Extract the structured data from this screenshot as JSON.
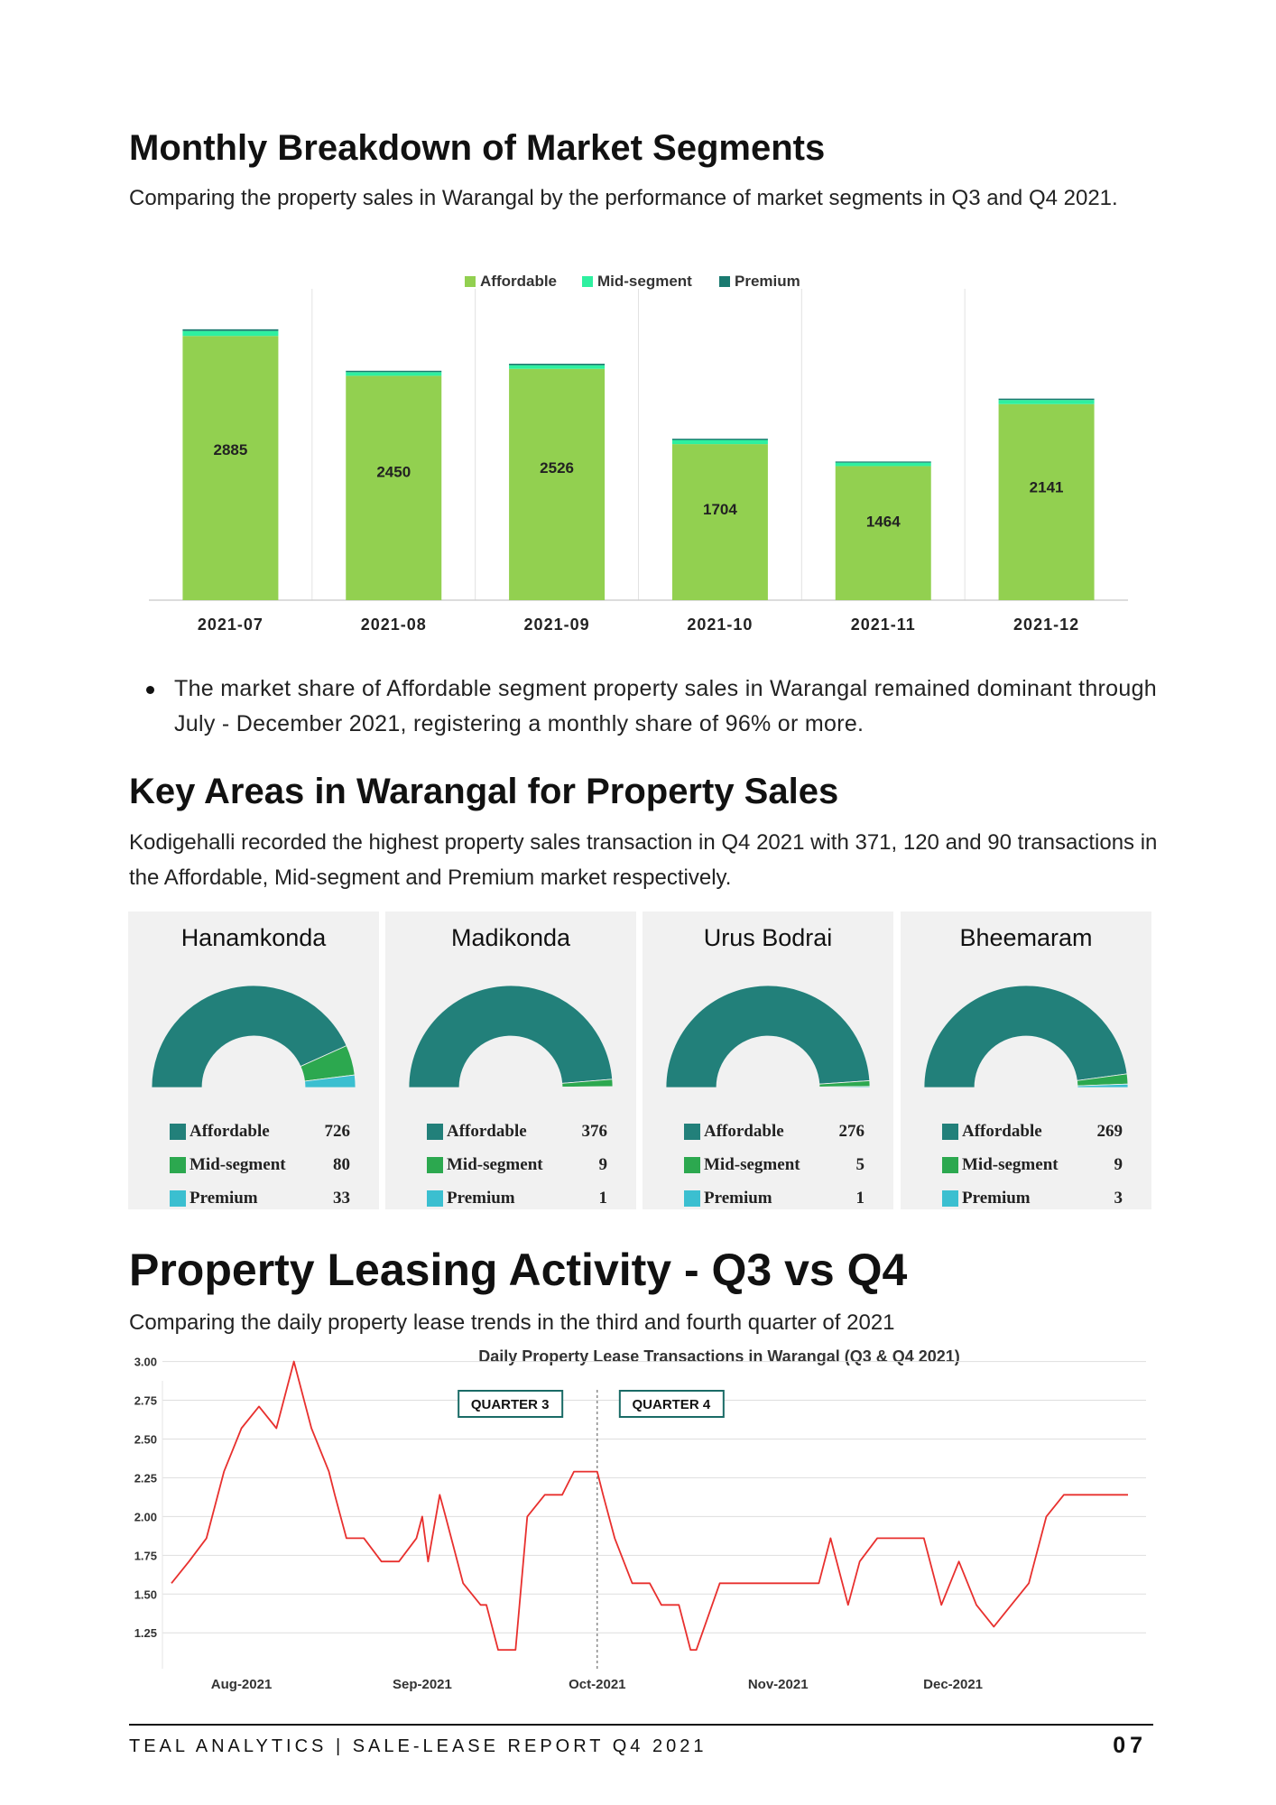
{
  "sections": {
    "monthly": {
      "heading": "Monthly Breakdown of Market Segments",
      "intro": "Comparing the property sales in Warangal  by the performance of market segments in Q3 and Q4 2021."
    },
    "bullet": "The market share of Affordable segment property sales in Warangal remained dominant through July - December 2021, registering a monthly share of 96% or more.",
    "key_areas": {
      "heading": "Key Areas in Warangal for Property Sales",
      "intro": "Kodigehalli recorded the highest property sales transaction in Q4 2021 with 371, 120 and 90 transactions in the Affordable, Mid-segment and Premium market respectively."
    },
    "leasing": {
      "heading": "Property Leasing Activity - Q3 vs Q4",
      "intro": "Comparing the daily property lease trends in the third and fourth quarter of 2021"
    }
  },
  "colors": {
    "affordable_bar": "#92d050",
    "mid_bar": "#2ef0a0",
    "premium_bar": "#1a7a70",
    "donut_affordable": "#22807a",
    "donut_mid": "#2ca84f",
    "donut_premium": "#3bbfd0",
    "line": "#e8302e"
  },
  "chart_data": [
    {
      "type": "bar",
      "stacked": true,
      "categories": [
        "2021-07",
        "2021-08",
        "2021-09",
        "2021-10",
        "2021-11",
        "2021-12"
      ],
      "series": [
        {
          "name": "Affordable",
          "values": [
            2885,
            2450,
            2526,
            1704,
            1464,
            2141
          ]
        },
        {
          "name": "Mid-segment",
          "values": [
            55,
            40,
            40,
            45,
            38,
            45
          ]
        },
        {
          "name": "Premium",
          "values": [
            18,
            15,
            16,
            14,
            12,
            15
          ]
        }
      ],
      "data_labels": [
        "2885",
        "2450",
        "2526",
        "1704",
        "1464",
        "2141"
      ],
      "legend": "top-center",
      "grid": false,
      "ylim": [
        0,
        3400
      ]
    },
    {
      "type": "pie",
      "variant": "half-donut",
      "title": "Hanamkonda",
      "labels": [
        "Affordable",
        "Mid-segment",
        "Premium"
      ],
      "values": [
        726,
        80,
        33
      ]
    },
    {
      "type": "pie",
      "variant": "half-donut",
      "title": "Madikonda",
      "labels": [
        "Affordable",
        "Mid-segment",
        "Premium"
      ],
      "values": [
        376,
        9,
        1
      ]
    },
    {
      "type": "pie",
      "variant": "half-donut",
      "title": "Urus Bodrai",
      "labels": [
        "Affordable",
        "Mid-segment",
        "Premium"
      ],
      "values": [
        276,
        5,
        1
      ]
    },
    {
      "type": "pie",
      "variant": "half-donut",
      "title": "Bheemaram",
      "labels": [
        "Affordable",
        "Mid-segment",
        "Premium"
      ],
      "values": [
        269,
        9,
        3
      ]
    },
    {
      "type": "line",
      "title": "Daily Property Lease Transactions in Warangal (Q3 & Q4 2021)",
      "x_tick_labels": [
        "Aug-2021",
        "Sep-2021",
        "Oct-2021",
        "Nov-2021",
        "Dec-2021"
      ],
      "y_ticks": [
        "1.25",
        "1.50",
        "1.75",
        "2.00",
        "2.25",
        "2.50",
        "2.75",
        "3.00"
      ],
      "ylim": [
        1.1,
        3.05
      ],
      "grid": true,
      "annotations": [
        "QUARTER 3",
        "QUARTER 4"
      ],
      "quarter_divider": "2021-10-01",
      "x": [
        "2021-07-20",
        "2021-07-23",
        "2021-07-26",
        "2021-07-29",
        "2021-08-01",
        "2021-08-04",
        "2021-08-07",
        "2021-08-10",
        "2021-08-13",
        "2021-08-16",
        "2021-08-17",
        "2021-08-19",
        "2021-08-22",
        "2021-08-25",
        "2021-08-28",
        "2021-08-31",
        "2021-09-01",
        "2021-09-02",
        "2021-09-04",
        "2021-09-05",
        "2021-09-08",
        "2021-09-11",
        "2021-09-12",
        "2021-09-14",
        "2021-09-17",
        "2021-09-18",
        "2021-09-19",
        "2021-09-22",
        "2021-09-25",
        "2021-09-27",
        "2021-09-29",
        "2021-09-30",
        "2021-10-01",
        "2021-10-02",
        "2021-10-04",
        "2021-10-07",
        "2021-10-10",
        "2021-10-12",
        "2021-10-15",
        "2021-10-17",
        "2021-10-18",
        "2021-10-22",
        "2021-10-24",
        "2021-11-01",
        "2021-11-05",
        "2021-11-08",
        "2021-11-10",
        "2021-11-13",
        "2021-11-15",
        "2021-11-18",
        "2021-11-20",
        "2021-11-23",
        "2021-11-26",
        "2021-11-29",
        "2021-12-02",
        "2021-12-05",
        "2021-12-08",
        "2021-12-11",
        "2021-12-14",
        "2021-12-17",
        "2021-12-20",
        "2021-12-23",
        "2021-12-25",
        "2021-12-28",
        "2021-12-31"
      ],
      "y": [
        1.57,
        1.71,
        1.86,
        2.29,
        2.57,
        2.71,
        2.57,
        3.0,
        2.57,
        2.29,
        2.14,
        1.86,
        1.86,
        1.71,
        1.71,
        1.86,
        2.0,
        1.71,
        2.14,
        2.0,
        1.57,
        1.43,
        1.43,
        1.14,
        1.14,
        1.57,
        2.0,
        2.14,
        2.14,
        2.29,
        2.29,
        2.29,
        2.29,
        2.14,
        1.86,
        1.57,
        1.57,
        1.43,
        1.43,
        1.14,
        1.14,
        1.57,
        1.57,
        1.57,
        1.57,
        1.57,
        1.86,
        1.43,
        1.71,
        1.86,
        1.86,
        1.86,
        1.86,
        1.43,
        1.71,
        1.43,
        1.29,
        1.43,
        1.57,
        2.0,
        2.14,
        2.14,
        2.14,
        2.14,
        2.14
      ]
    }
  ],
  "footer": {
    "text": "TEAL ANALYTICS | SALE-LEASE REPORT Q4 2021",
    "page": "07"
  }
}
